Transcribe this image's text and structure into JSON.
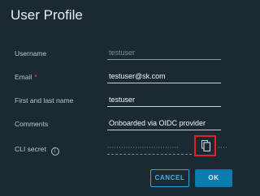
{
  "dialog": {
    "title": "User Profile"
  },
  "fields": [
    {
      "label": "Username",
      "value": "testuser",
      "required": false,
      "readonly": true
    },
    {
      "label": "Email",
      "value": "testuser@sk.com",
      "required": true,
      "required_mark": "*"
    },
    {
      "label": "First and last name",
      "value": "testuser",
      "required": false
    },
    {
      "label": "Comments",
      "value": "Onboarded via OIDC provider",
      "required": false
    }
  ],
  "cli_secret": {
    "label": "CLI secret",
    "info_icon": "info-icon",
    "masked_value": "·······························",
    "trailing_dots": "····",
    "copy_icon": "copy-icon"
  },
  "buttons": {
    "cancel_label": "CANCEL",
    "ok_label": "OK"
  },
  "colors": {
    "background": "#1b2a32",
    "accent": "#0a7cb0",
    "highlight": "#e01f26"
  }
}
